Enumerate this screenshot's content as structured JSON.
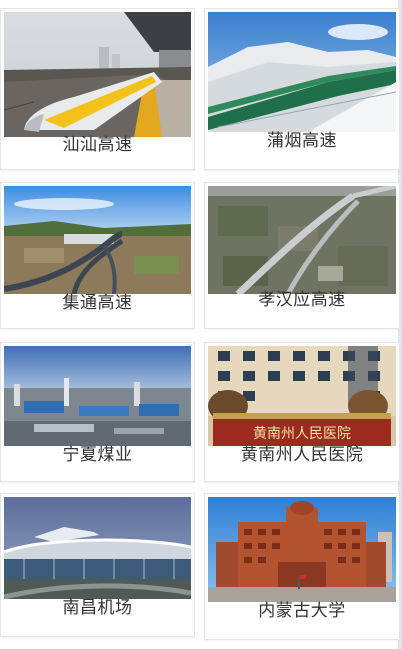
{
  "projects": {
    "items": [
      {
        "label": "汕汕高速",
        "image_icon": "high-speed-train-photo"
      },
      {
        "label": "蒲烟高速",
        "image_icon": "snowy-highway-photo"
      },
      {
        "label": "集通高速",
        "image_icon": "highway-interchange-photo"
      },
      {
        "label": "孝汉应高速",
        "image_icon": "elevated-highway-photo"
      },
      {
        "label": "宁夏煤业",
        "image_icon": "industrial-plant-photo"
      },
      {
        "label": "黄南州人民医院",
        "image_icon": "hospital-building-photo"
      },
      {
        "label": "南昌机场",
        "image_icon": "airport-terminal-photo"
      },
      {
        "label": "内蒙古大学",
        "image_icon": "university-building-photo"
      }
    ]
  },
  "photo_texts": {
    "hospital_sign": "黄南州人民医院"
  }
}
